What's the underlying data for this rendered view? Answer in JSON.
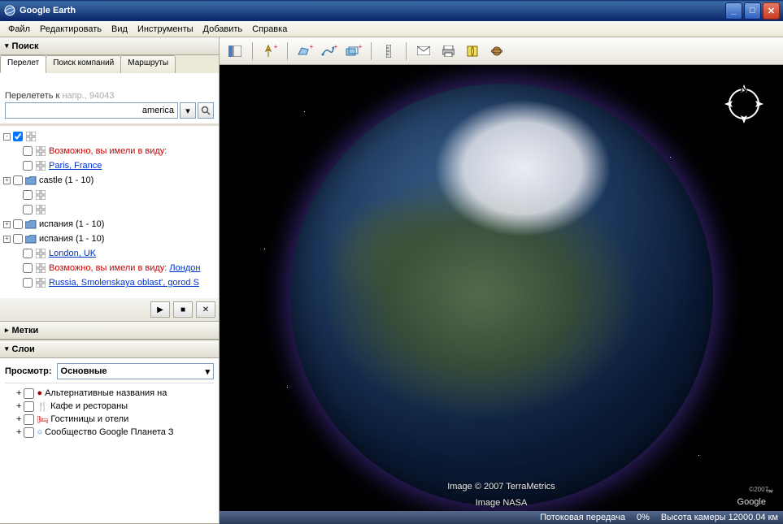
{
  "window": {
    "title": "Google Earth"
  },
  "menu": {
    "items": [
      "Файл",
      "Редактировать",
      "Вид",
      "Инструменты",
      "Добавить",
      "Справка"
    ]
  },
  "sidebar": {
    "search": {
      "title": "Поиск",
      "tabs": [
        "Перелет",
        "Поиск компаний",
        "Маршруты"
      ],
      "flyto_label": "Перелететь к",
      "flyto_hint": "напр., 94043",
      "input_value": "america",
      "results": [
        {
          "exp": "-",
          "checked": true,
          "icon": "grid",
          "label": "",
          "cls": ""
        },
        {
          "exp": "",
          "checked": false,
          "icon": "grid",
          "label": "Возможно, вы имели в виду:",
          "cls": "red"
        },
        {
          "exp": "",
          "checked": false,
          "icon": "grid",
          "label": "Paris, France",
          "cls": "link"
        },
        {
          "exp": "+",
          "checked": false,
          "icon": "folder",
          "label": "castle (1 - 10)",
          "cls": ""
        },
        {
          "exp": "",
          "checked": false,
          "icon": "grid",
          "label": "",
          "cls": ""
        },
        {
          "exp": "",
          "checked": false,
          "icon": "grid",
          "label": "",
          "cls": ""
        },
        {
          "exp": "+",
          "checked": false,
          "icon": "folder",
          "label": "испания (1 - 10)",
          "cls": ""
        },
        {
          "exp": "+",
          "checked": false,
          "icon": "folder",
          "label": "испания (1 - 10)",
          "cls": ""
        },
        {
          "exp": "",
          "checked": false,
          "icon": "grid",
          "label": "London, UK",
          "cls": "link"
        },
        {
          "exp": "",
          "checked": false,
          "icon": "grid",
          "label": "Возможно, вы имели в виду: Лондон",
          "cls": "red",
          "linkpart": "Лондон"
        },
        {
          "exp": "",
          "checked": false,
          "icon": "grid",
          "label": "Russia, Smolenskaya oblast', gorod S",
          "cls": "link"
        }
      ]
    },
    "places": {
      "title": "Метки"
    },
    "layers": {
      "title": "Слои",
      "view_label": "Просмотр:",
      "view_value": "Основные",
      "items": [
        {
          "exp": "",
          "icon": "●",
          "color": "#900",
          "label": "Альтернативные названия на"
        },
        {
          "exp": "+",
          "icon": "🍴",
          "color": "#333",
          "label": "Кафе и рестораны"
        },
        {
          "exp": "",
          "icon": "🛏",
          "color": "#b00",
          "label": "Гостиницы и отели"
        },
        {
          "exp": "+",
          "icon": "○",
          "color": "#06c",
          "label": "Сообщество Google Планета З"
        }
      ]
    }
  },
  "viewport": {
    "attribution1": "Image © 2007 TerraMetrics",
    "attribution2": "Image NASA",
    "logo": "Google",
    "logo_tm": "™",
    "year": "©2007"
  },
  "status": {
    "stream": "Потоковая передача",
    "percent": "0%",
    "alt": "Высота камеры 12000.04 км"
  }
}
